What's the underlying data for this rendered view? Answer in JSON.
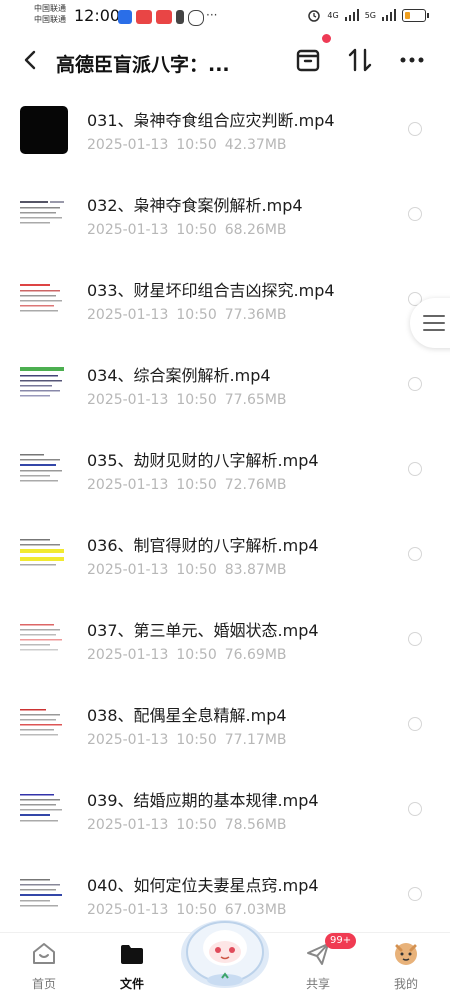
{
  "status_bar": {
    "carrier_1": "中国联通",
    "carrier_2": "中国联通",
    "time": "12:00",
    "network_1": "4G",
    "network_2": "5G"
  },
  "header": {
    "title": "高德臣盲派八字：...",
    "back_icon": "chevron-left-icon",
    "icons": [
      "archive-box-icon",
      "sort-updown-icon",
      "more-dots-icon"
    ]
  },
  "files": [
    {
      "name": "031、枭神夺食组合应灾判断.mp4",
      "date": "2025-01-13",
      "time": "10:50",
      "size": "42.37MB"
    },
    {
      "name": "032、枭神夺食案例解析.mp4",
      "date": "2025-01-13",
      "time": "10:50",
      "size": "68.26MB"
    },
    {
      "name": "033、财星坏印组合吉凶探究.mp4",
      "date": "2025-01-13",
      "time": "10:50",
      "size": "77.36MB"
    },
    {
      "name": "034、综合案例解析.mp4",
      "date": "2025-01-13",
      "time": "10:50",
      "size": "77.65MB"
    },
    {
      "name": "035、劫财见财的八字解析.mp4",
      "date": "2025-01-13",
      "time": "10:50",
      "size": "72.76MB"
    },
    {
      "name": "036、制官得财的八字解析.mp4",
      "date": "2025-01-13",
      "time": "10:50",
      "size": "83.87MB"
    },
    {
      "name": "037、第三单元、婚姻状态.mp4",
      "date": "2025-01-13",
      "time": "10:50",
      "size": "76.69MB"
    },
    {
      "name": "038、配偶星全息精解.mp4",
      "date": "2025-01-13",
      "time": "10:50",
      "size": "77.17MB"
    },
    {
      "name": "039、结婚应期的基本规律.mp4",
      "date": "2025-01-13",
      "time": "10:50",
      "size": "78.56MB"
    },
    {
      "name": "040、如何定位夫妻星点窍.mp4",
      "date": "2025-01-13",
      "time": "10:50",
      "size": "67.03MB"
    }
  ],
  "nav": {
    "home": "首页",
    "files": "文件",
    "share": "共享",
    "mine": "我的",
    "badge": "99+"
  },
  "colors": {
    "accent_red": "#ee3b55",
    "meta_gray": "#b7b7b7",
    "title_black": "#111111"
  }
}
